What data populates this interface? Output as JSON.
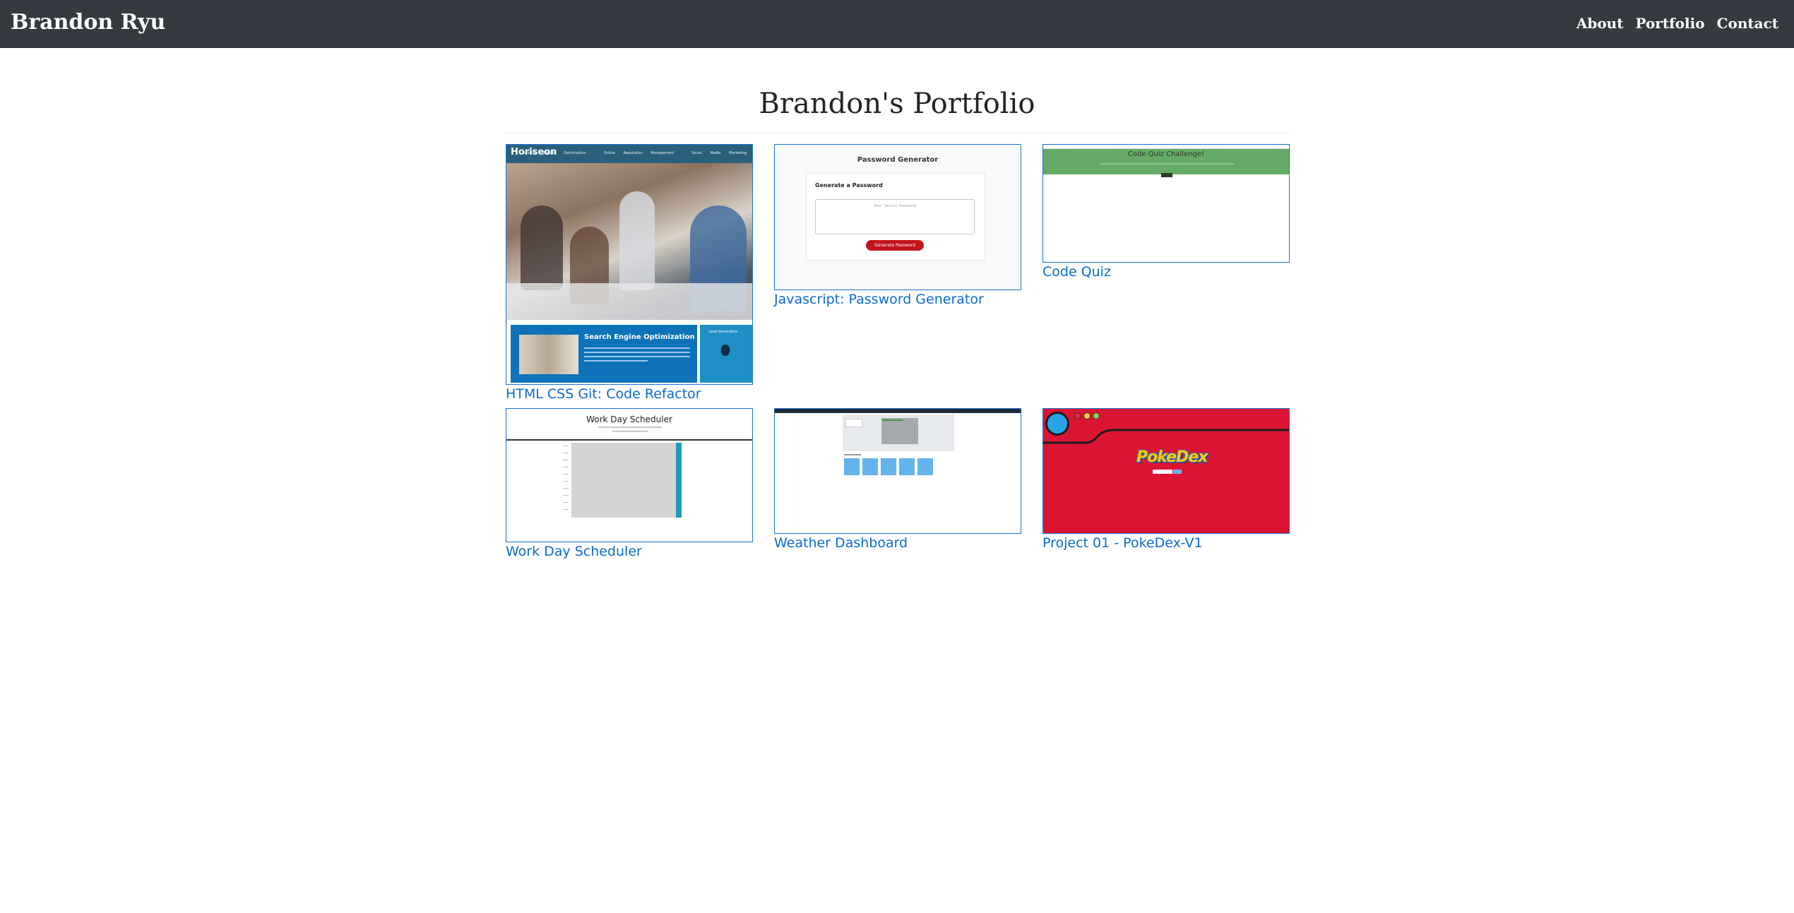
{
  "navbar": {
    "brand": "Brandon Ryu",
    "links": [
      "About",
      "Portfolio",
      "Contact"
    ]
  },
  "page": {
    "title": "Brandon's Portfolio"
  },
  "projects": [
    {
      "label": "HTML CSS Git: Code Refactor",
      "thumb": {
        "logo": "Horiseon",
        "nav": "Search Engine Optimization · Online Reputation Management · Social Media Marketing",
        "section_title": "Search Engine Optimization",
        "sidebar_title": "Lead Generation"
      }
    },
    {
      "label": "Javascript: Password Generator",
      "thumb": {
        "title": "Password Generator",
        "card_title": "Generate a Password",
        "placeholder": "Your Secure Password",
        "button": "Generate Password"
      }
    },
    {
      "label": "Code Quiz",
      "thumb": {
        "title": "Code Quiz Challenge!"
      }
    },
    {
      "label": "Work Day Scheduler",
      "thumb": {
        "title": "Work Day Scheduler"
      }
    },
    {
      "label": "Weather Dashboard",
      "thumb": {}
    },
    {
      "label": "Project 01 - PokeDex-V1",
      "thumb": {
        "logo": "PokeDex"
      }
    }
  ],
  "colors": {
    "navbar_bg": "#343a40",
    "link": "#0b6bce",
    "thumb_border": "#1a73d9",
    "pokedex_red": "#dc1433",
    "quiz_green": "#65ab67"
  }
}
